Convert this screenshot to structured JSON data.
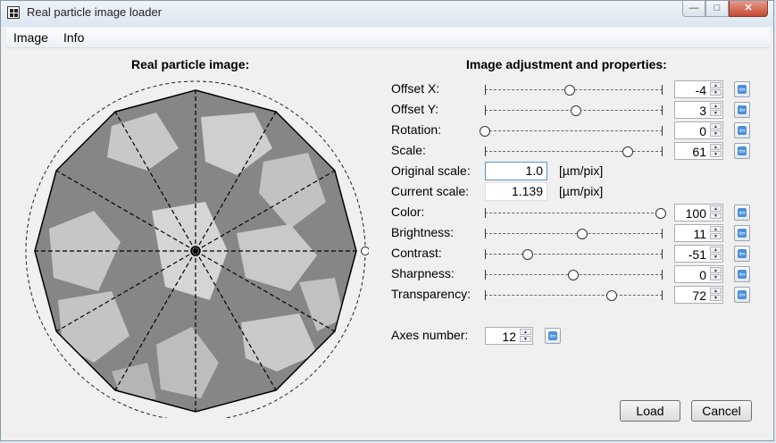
{
  "window": {
    "title": "Real particle image loader",
    "icon": "app-grid-icon",
    "buttons": {
      "minimize": "minimize-icon",
      "maximize": "maximize-icon",
      "close": "close-icon"
    }
  },
  "menu": {
    "items": [
      "Image",
      "Info"
    ]
  },
  "left_panel": {
    "heading": "Real particle image:"
  },
  "right_panel": {
    "heading": "Image adjustment and properties:"
  },
  "sliders": [
    {
      "label": "Offset X:",
      "value": "-4",
      "position": 0.48
    },
    {
      "label": "Offset Y:",
      "value": "3",
      "position": 0.52
    },
    {
      "label": "Rotation:",
      "value": "0",
      "position": 0.0
    },
    {
      "label": "Scale:",
      "value": "61",
      "position": 0.81
    }
  ],
  "scales": {
    "original": {
      "label": "Original scale:",
      "value": "1.0",
      "unit": "[µm/pix]"
    },
    "current": {
      "label": "Current scale:",
      "value": "1.139",
      "unit": "[µm/pix]"
    }
  },
  "sliders2": [
    {
      "label": "Color:",
      "value": "100",
      "position": 1.0
    },
    {
      "label": "Brightness:",
      "value": "11",
      "position": 0.555
    },
    {
      "label": "Contrast:",
      "value": "-51",
      "position": 0.245
    },
    {
      "label": "Sharpness:",
      "value": "0",
      "position": 0.5
    },
    {
      "label": "Transparency:",
      "value": "72",
      "position": 0.72
    }
  ],
  "axes": {
    "label": "Axes number:",
    "value": "12"
  },
  "buttons": {
    "load": "Load",
    "cancel": "Cancel"
  },
  "icons": {
    "reset": "reset-arrow-icon",
    "spin_up": "spin-up-icon",
    "spin_down": "spin-down-icon"
  },
  "colors": {
    "accent": "#4a90d9",
    "image_bg": "#8c8c8c",
    "close_btn": "#c44a33"
  }
}
